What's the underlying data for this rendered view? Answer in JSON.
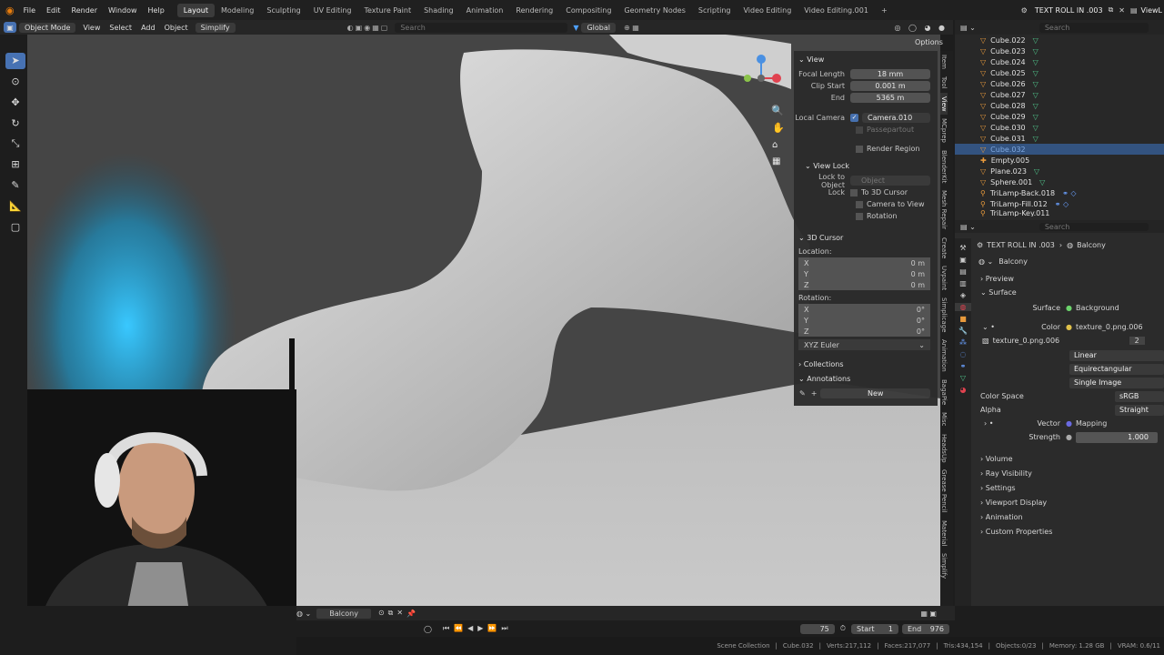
{
  "menu": [
    "File",
    "Edit",
    "Render",
    "Window",
    "Help"
  ],
  "workspaces": [
    "Layout",
    "Modeling",
    "Sculpting",
    "UV Editing",
    "Texture Paint",
    "Shading",
    "Animation",
    "Rendering",
    "Compositing",
    "Geometry Nodes",
    "Scripting",
    "Video Editing",
    "Video Editing.001"
  ],
  "add_workspace": "+",
  "scene_name": "TEXT ROLL IN .003",
  "view_layer": "ViewL",
  "header": {
    "mode": "Object Mode",
    "view": "View",
    "select": "Select",
    "add": "Add",
    "object": "Object",
    "simplify": "Simplify",
    "orientation": "Global",
    "search_placeholder": "Search",
    "options": "Options"
  },
  "npanel": {
    "view_title": "View",
    "focal_length_label": "Focal Length",
    "focal_length": "18 mm",
    "clip_start_label": "Clip Start",
    "clip_start": "0.001 m",
    "end_label": "End",
    "end": "5365 m",
    "local_camera_label": "Local Camera",
    "local_camera": "Camera.010",
    "passepartout": "Passepartout",
    "render_region": "Render Region",
    "view_lock_title": "View Lock",
    "lock_to_object_label": "Lock to Object",
    "lock_to_object_placeholder": "Object",
    "lock_label": "Lock",
    "to_3d_cursor": "To 3D Cursor",
    "camera_to_view": "Camera to View",
    "rotation_lock": "Rotation",
    "cursor_title": "3D Cursor",
    "location_label": "Location:",
    "loc": [
      {
        "axis": "X",
        "value": "0 m"
      },
      {
        "axis": "Y",
        "value": "0 m"
      },
      {
        "axis": "Z",
        "value": "0 m"
      }
    ],
    "rotation_label": "Rotation:",
    "rot": [
      {
        "axis": "X",
        "value": "0°"
      },
      {
        "axis": "Y",
        "value": "0°"
      },
      {
        "axis": "Z",
        "value": "0°"
      }
    ],
    "rotation_mode": "XYZ Euler",
    "collections": "Collections",
    "annotations": "Annotations",
    "new": "New"
  },
  "side_tabs": [
    "Item",
    "Tool",
    "View",
    "MCprep",
    "BlenderKit",
    "Mesh Repair",
    "Create",
    "Uvpaint",
    "Simplicage",
    "Animation",
    "BagaPie",
    "Misc",
    "HeadsUp",
    "Grease Pencil",
    "Material",
    "Simplify"
  ],
  "outliner": {
    "search_placeholder": "Search",
    "items": [
      "Cube.022",
      "Cube.023",
      "Cube.024",
      "Cube.025",
      "Cube.026",
      "Cube.027",
      "Cube.028",
      "Cube.029",
      "Cube.030",
      "Cube.031",
      "Cube.032",
      "Empty.005",
      "Plane.023",
      "Sphere.001",
      "TriLamp-Back.018",
      "TriLamp-Fill.012",
      "TriLamp-Key.011"
    ]
  },
  "properties": {
    "search_placeholder": "Search",
    "breadcrumb_scene": "TEXT ROLL IN .003",
    "breadcrumb_world": "Balcony",
    "world_name": "Balcony",
    "preview": "Preview",
    "surface_panel": "Surface",
    "surface_label": "Surface",
    "surface_value": "Background",
    "color_label": "Color",
    "color_value": "texture_0.png.006",
    "image_name": "texture_0.png.006",
    "image_users": "2",
    "interpolation": "Linear",
    "projection": "Equirectangular",
    "source": "Single Image",
    "color_space_label": "Color Space",
    "color_space": "sRGB",
    "alpha_label": "Alpha",
    "alpha": "Straight",
    "vector_label": "Vector",
    "vector_value": "Mapping",
    "strength_label": "Strength",
    "strength": "1.000",
    "panels": [
      "Volume",
      "Ray Visibility",
      "Settings",
      "Viewport Display",
      "Animation",
      "Custom Properties"
    ]
  },
  "viewport_footer": {
    "world": "Balcony"
  },
  "timeline": {
    "current_frame": "75",
    "start_label": "Start",
    "start": "1",
    "end_label": "End",
    "end": "976"
  },
  "status": {
    "collection": "Scene Collection",
    "object": "Cube.032",
    "verts": "Verts:217,112",
    "faces": "Faces:217,077",
    "tris": "Tris:434,154",
    "objects": "Objects:0/23",
    "memory": "Memory: 1.28 GB",
    "vram": "VRAM: 0.6/11"
  }
}
